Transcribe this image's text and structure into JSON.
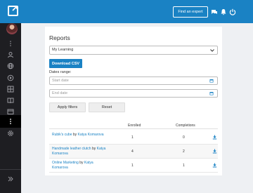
{
  "topbar": {
    "expert_button": "Find an expert",
    "icons": [
      "chat-icon",
      "bell-icon",
      "power-icon"
    ]
  },
  "sidebar": {
    "icons": [
      "more-icon",
      "user-icon",
      "globe-icon",
      "play-icon",
      "grid-icon",
      "book-icon",
      "store-icon",
      "reports-icon",
      "gear-icon",
      "expand-icon"
    ]
  },
  "reports": {
    "title": "Reports",
    "course_select": "My Learning",
    "download_csv": "Download CSV",
    "dates_range_label": "Dates range:",
    "start_date_placeholder": "Start date",
    "end_date_placeholder": "End date",
    "apply_button": "Apply filters",
    "reset_button": "Reset"
  },
  "table": {
    "headers": {
      "enrolled": "Enrolled",
      "completions": "Completions"
    },
    "rows": [
      {
        "course": "Rubik's cube",
        "by": "by",
        "author": "Katya Komarova",
        "enrolled": "1",
        "completions": "0"
      },
      {
        "course": "Handmade leather clutch",
        "by": "by",
        "author": "Katya Komarova",
        "enrolled": "4",
        "completions": "2"
      },
      {
        "course": "Online Marketing",
        "by": "by",
        "author": "Katya Komarova",
        "enrolled": "1",
        "completions": "1"
      }
    ]
  },
  "colors": {
    "accent": "#1a82c4",
    "sidebar": "#1e1e22",
    "background": "#eef0f3"
  }
}
